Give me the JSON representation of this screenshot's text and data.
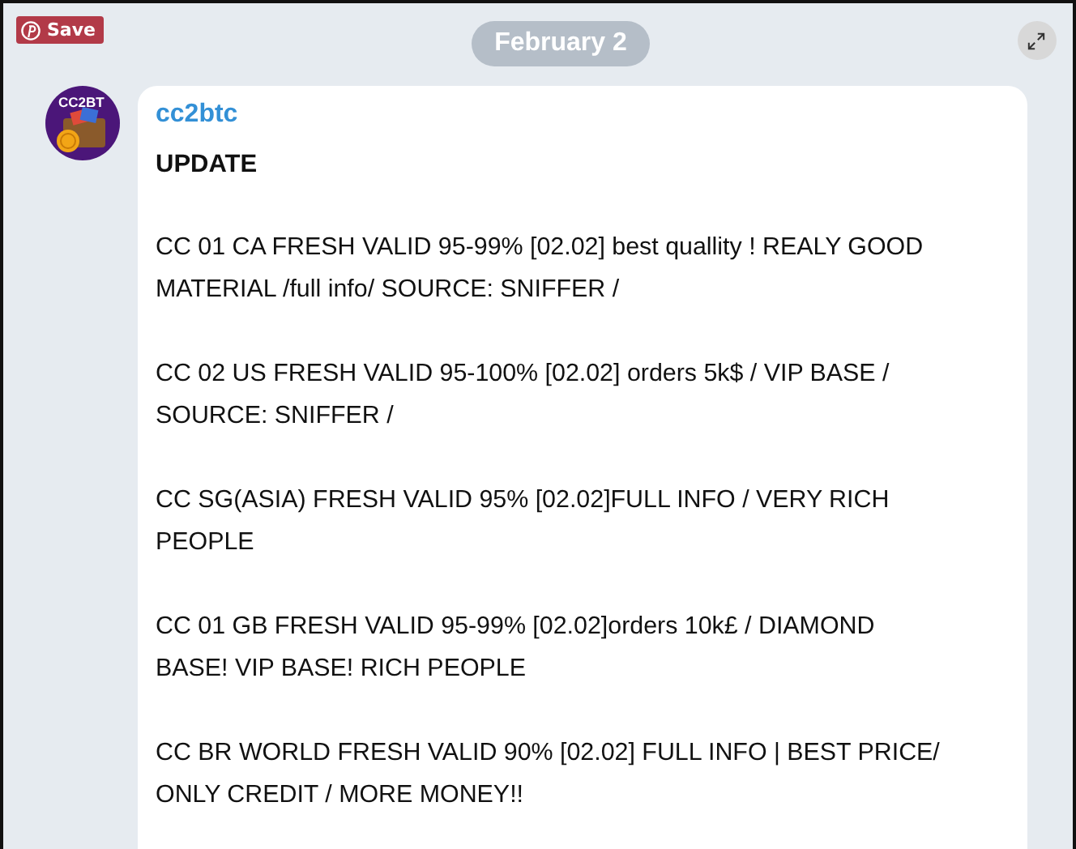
{
  "save_button": {
    "label": "Save"
  },
  "date_badge": "February 2",
  "message": {
    "avatar_text": "CC2BT",
    "sender": "cc2btc",
    "heading": "UPDATE",
    "paragraphs": [
      [
        "CC 01 CA FRESH VALID 95-99% [02.02] best quallity ! REALY GOOD",
        "MATERIAL /full info/ SOURCE: SNIFFER /"
      ],
      [
        "CC 02 US FRESH VALID 95-100% [02.02] orders 5k$ / VIP BASE /",
        "SOURCE: SNIFFER /"
      ],
      [
        "CC SG(ASIA) FRESH VALID 95% [02.02]FULL INFO / VERY RICH",
        "PEOPLE"
      ],
      [
        "CC 01 GB FRESH VALID 95-99% [02.02]orders 10k£ / DIAMOND",
        "BASE! VIP BASE! RICH PEOPLE"
      ],
      [
        "CC BR WORLD FRESH VALID 90% [02.02] FULL INFO | BEST PRICE/",
        "ONLY CREDIT / MORE MONEY!!"
      ]
    ]
  }
}
